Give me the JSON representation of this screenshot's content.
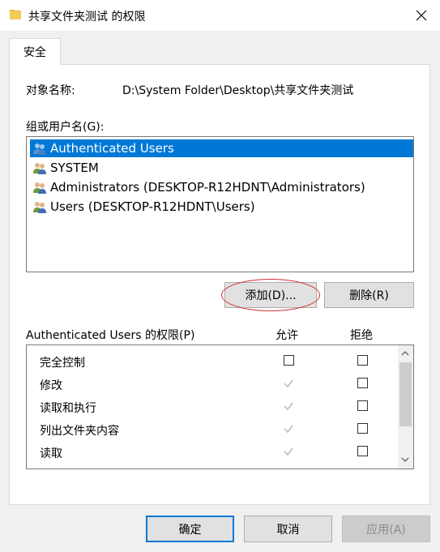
{
  "window": {
    "title": "共享文件夹测试 的权限"
  },
  "tabs": [
    {
      "label": "安全"
    }
  ],
  "object": {
    "label": "对象名称:",
    "value": "D:\\System Folder\\Desktop\\共享文件夹测试"
  },
  "groups": {
    "label": "组或用户名(G):",
    "items": [
      {
        "label": "Authenticated Users",
        "selected": true
      },
      {
        "label": "SYSTEM",
        "selected": false
      },
      {
        "label": "Administrators (DESKTOP-R12HDNT\\Administrators)",
        "selected": false
      },
      {
        "label": "Users (DESKTOP-R12HDNT\\Users)",
        "selected": false
      }
    ]
  },
  "buttons": {
    "add": "添加(D)...",
    "remove": "删除(R)",
    "ok": "确定",
    "cancel": "取消",
    "apply": "应用(A)"
  },
  "permissions": {
    "label": "Authenticated Users 的权限(P)",
    "allow_header": "允许",
    "deny_header": "拒绝",
    "rows": [
      {
        "label": "完全控制",
        "allow": "unchecked",
        "deny": "unchecked"
      },
      {
        "label": "修改",
        "allow": "inherited-checked",
        "deny": "unchecked"
      },
      {
        "label": "读取和执行",
        "allow": "inherited-checked",
        "deny": "unchecked"
      },
      {
        "label": "列出文件夹内容",
        "allow": "inherited-checked",
        "deny": "unchecked"
      },
      {
        "label": "读取",
        "allow": "inherited-checked",
        "deny": "unchecked"
      }
    ]
  },
  "colors": {
    "selection": "#0078d7",
    "highlight_ellipse": "#d32f2f",
    "default_button_border": "#0078d7"
  }
}
